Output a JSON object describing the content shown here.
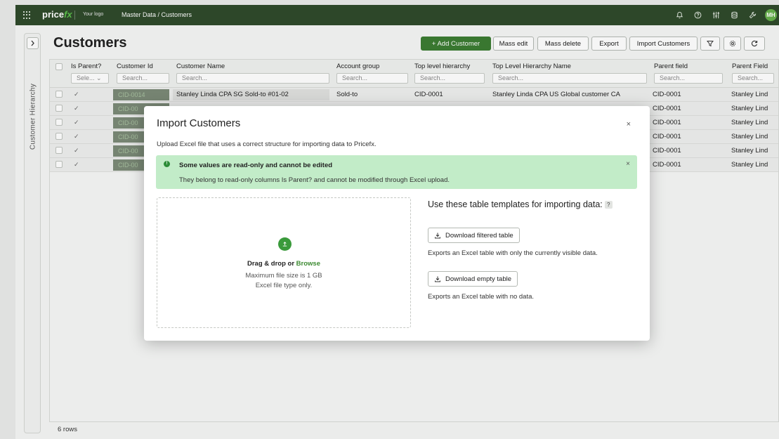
{
  "topbar": {
    "brand_main": "price",
    "brand_accent": "fx",
    "your_logo": "Your logo",
    "breadcrumb": "Master Data / Customers",
    "avatar_initials": "MH"
  },
  "sidebar": {
    "label": "Customer Hierarchy",
    "toggle_icon": "chevron-right-icon"
  },
  "page": {
    "title": "Customers"
  },
  "toolbar": {
    "add_customer": "+ Add Customer",
    "mass_edit": "Mass edit",
    "mass_delete": "Mass delete",
    "export": "Export",
    "import_customers": "Import Customers"
  },
  "table": {
    "columns": [
      {
        "label": "Is Parent?",
        "filter": "Sele... ⌄"
      },
      {
        "label": "Customer Id",
        "filter": "Search..."
      },
      {
        "label": "Customer Name",
        "filter": "Search..."
      },
      {
        "label": "Account group",
        "filter": "Search..."
      },
      {
        "label": "Top level hierarchy",
        "filter": "Search..."
      },
      {
        "label": "Top Level Hierarchy Name",
        "filter": "Search..."
      },
      {
        "label": "Parent field",
        "filter": "Search..."
      },
      {
        "label": "Parent Field",
        "filter": "Search..."
      }
    ],
    "rows": [
      {
        "is_parent": "✓",
        "customer_id": "CID-0014",
        "name": "Stanley Linda CPA SG Sold-to #01-02",
        "account_group": "Sold-to",
        "top_level": "CID-0001",
        "top_level_name": "Stanley Linda CPA US Global customer CA",
        "parent_field": "CID-0001",
        "parent_field_name": "Stanley Lind"
      },
      {
        "is_parent": "✓",
        "customer_id": "CID-00",
        "parent_field": "CID-0001",
        "parent_field_name": "Stanley Lind"
      },
      {
        "is_parent": "✓",
        "customer_id": "CID-00",
        "parent_field": "CID-0001",
        "parent_field_name": "Stanley Lind"
      },
      {
        "is_parent": "✓",
        "customer_id": "CID-00",
        "parent_field": "CID-0001",
        "parent_field_name": "Stanley Lind"
      },
      {
        "is_parent": "✓",
        "customer_id": "CID-00",
        "parent_field": "CID-0001",
        "parent_field_name": "Stanley Lind"
      },
      {
        "is_parent": "✓",
        "customer_id": "CID-00",
        "parent_field": "CID-0001",
        "parent_field_name": "Stanley Lind"
      }
    ],
    "row_count": "6 rows"
  },
  "modal": {
    "title": "Import Customers",
    "close": "×",
    "subtitle": "Upload Excel file that uses a correct structure for importing data to Pricefx.",
    "alert": {
      "title": "Some values are read-only and cannot be edited",
      "desc": "They belong to read-only columns Is Parent? and cannot be modified through Excel upload.",
      "close": "×"
    },
    "drop": {
      "prefix": "Drag & drop or ",
      "browse": "Browse",
      "max_size": "Maximum file size is 1 GB",
      "file_type": "Excel file type only."
    },
    "templates": {
      "title": "Use these table templates for importing data:",
      "help": "?",
      "filtered_button": "Download filtered table",
      "filtered_desc": "Exports an Excel table with only the currently visible data.",
      "empty_button": "Download empty table",
      "empty_desc": "Exports an Excel table with no data."
    }
  }
}
